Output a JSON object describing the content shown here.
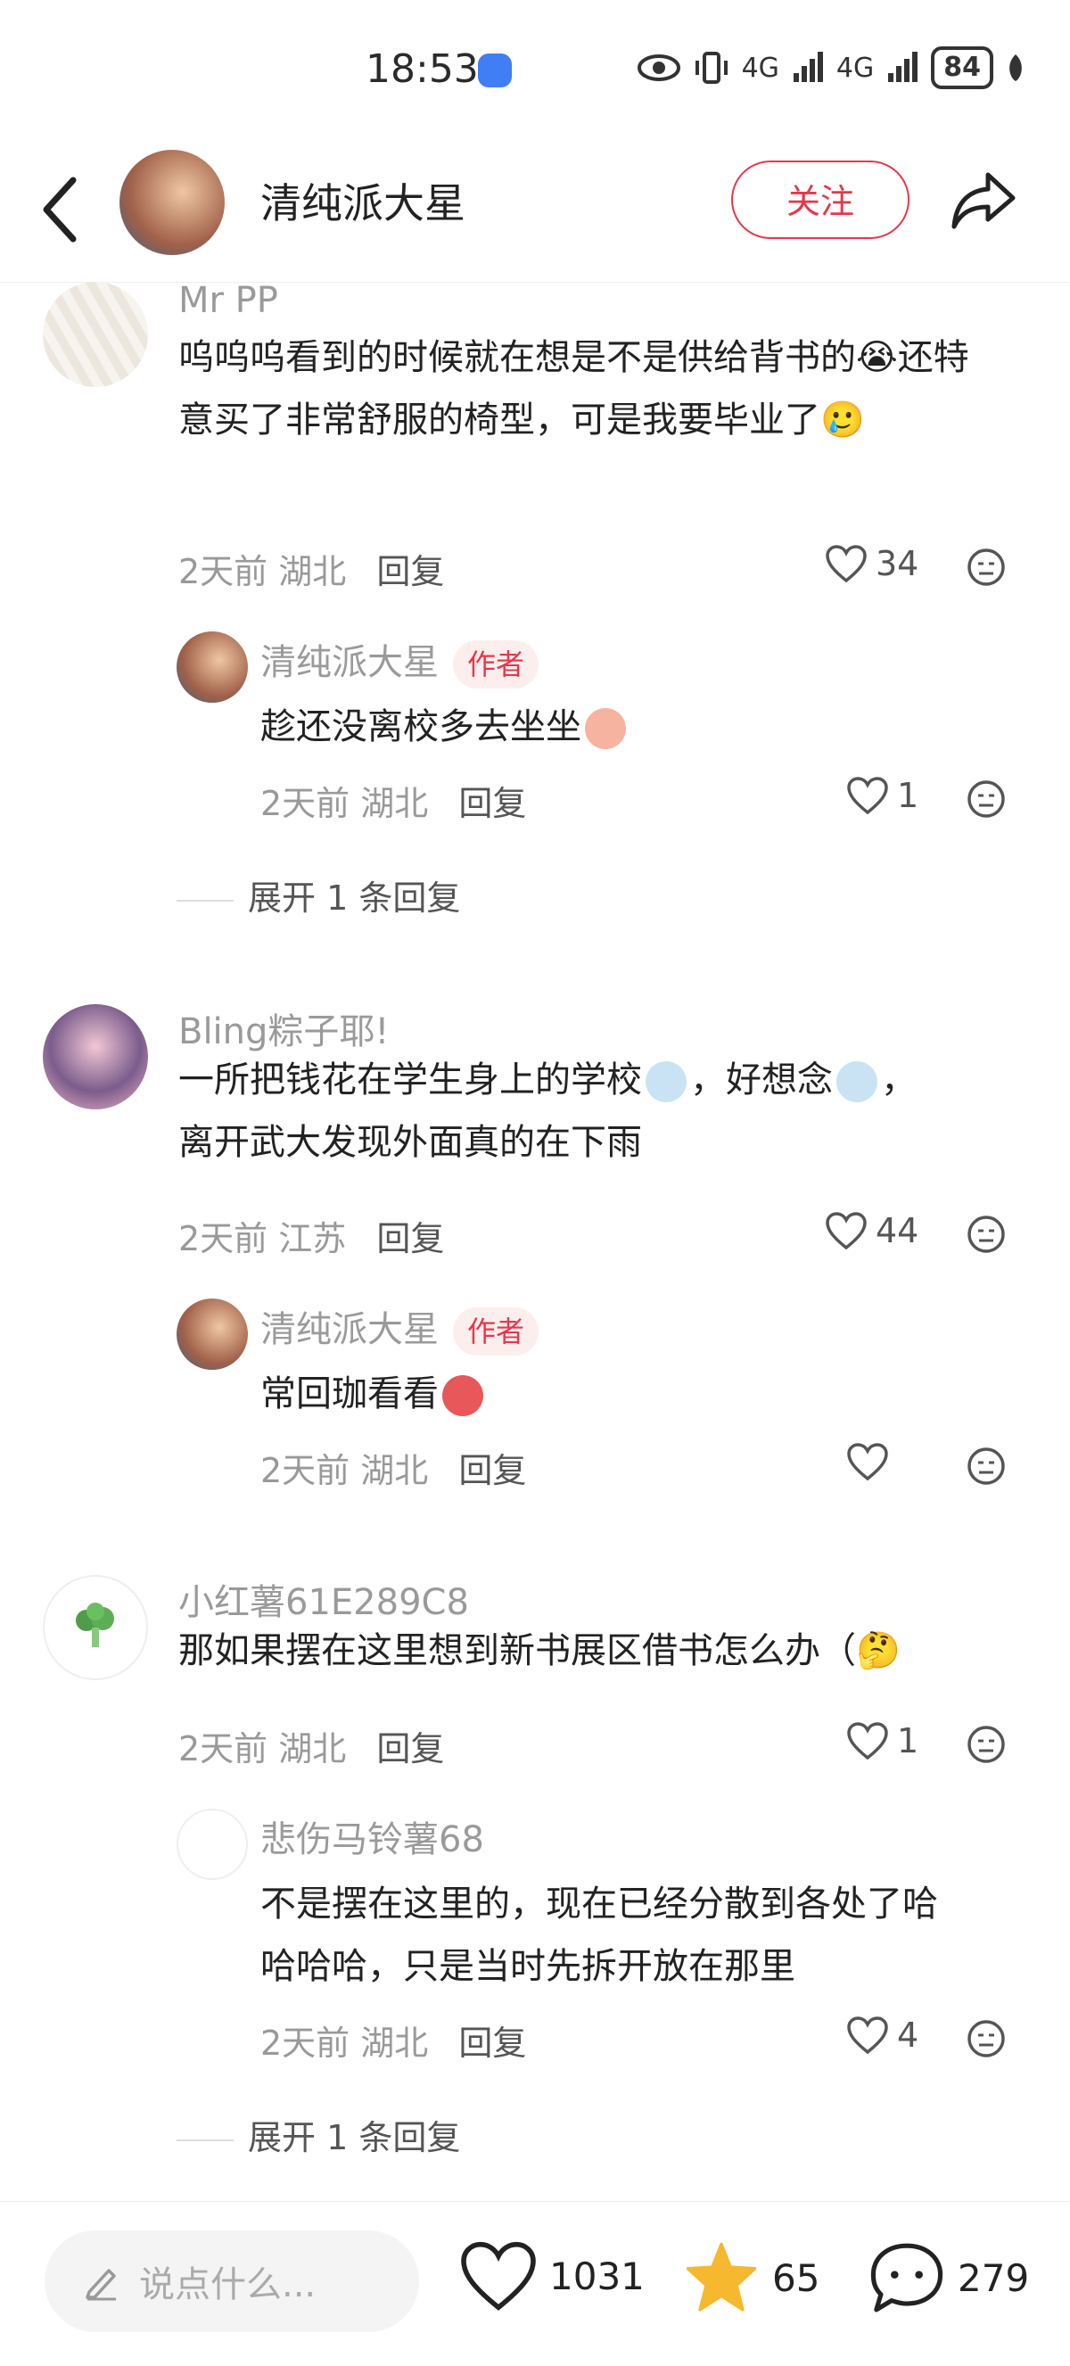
{
  "status_bar": {
    "time": "18:53",
    "network1": "4G",
    "network2": "4G",
    "battery": "84"
  },
  "header": {
    "author_name": "清纯派大星",
    "follow_label": "关注"
  },
  "author_tag": "作者",
  "comments": [
    {
      "user": "Mr PP",
      "text": "呜呜呜看到的时候就在想是不是供给背书的😭还特意买了非常舒服的椅型，可是我要毕业了🥲",
      "time": "2天前",
      "location": "湖北",
      "reply_label": "回复",
      "likes": "34",
      "reply": {
        "user": "清纯派大星",
        "text": "趁还没离校多去坐坐",
        "time": "2天前",
        "location": "湖北",
        "reply_label": "回复",
        "likes": "1"
      },
      "expand": "展开 1 条回复"
    },
    {
      "user": "Bling粽子耶!",
      "text": "一所把钱花在学生身上的学校",
      "text_mid": "，好想念",
      "text_end": "，",
      "text2": "离开武大发现外面真的在下雨",
      "time": "2天前",
      "location": "江苏",
      "reply_label": "回复",
      "likes": "44",
      "reply": {
        "user": "清纯派大星",
        "text": "常回珈看看",
        "time": "2天前",
        "location": "湖北",
        "reply_label": "回复",
        "likes": ""
      }
    },
    {
      "user": "小红薯61E289C8",
      "text": "那如果摆在这里想到新书展区借书怎么办（🤔",
      "time": "2天前",
      "location": "湖北",
      "reply_label": "回复",
      "likes": "1",
      "reply": {
        "user": "悲伤马铃薯68",
        "text": "不是摆在这里的，现在已经分散到各处了哈",
        "text2": "哈哈哈，只是当时先拆开放在那里",
        "time": "2天前",
        "location": "湖北",
        "reply_label": "回复",
        "likes": "4"
      },
      "expand": "展开 1 条回复"
    }
  ],
  "bottom_bar": {
    "input_placeholder": "说点什么...",
    "likes": "1031",
    "stars": "65",
    "comments": "279"
  },
  "colors": {
    "accent": "#e8374a",
    "star": "#f5b82e"
  }
}
